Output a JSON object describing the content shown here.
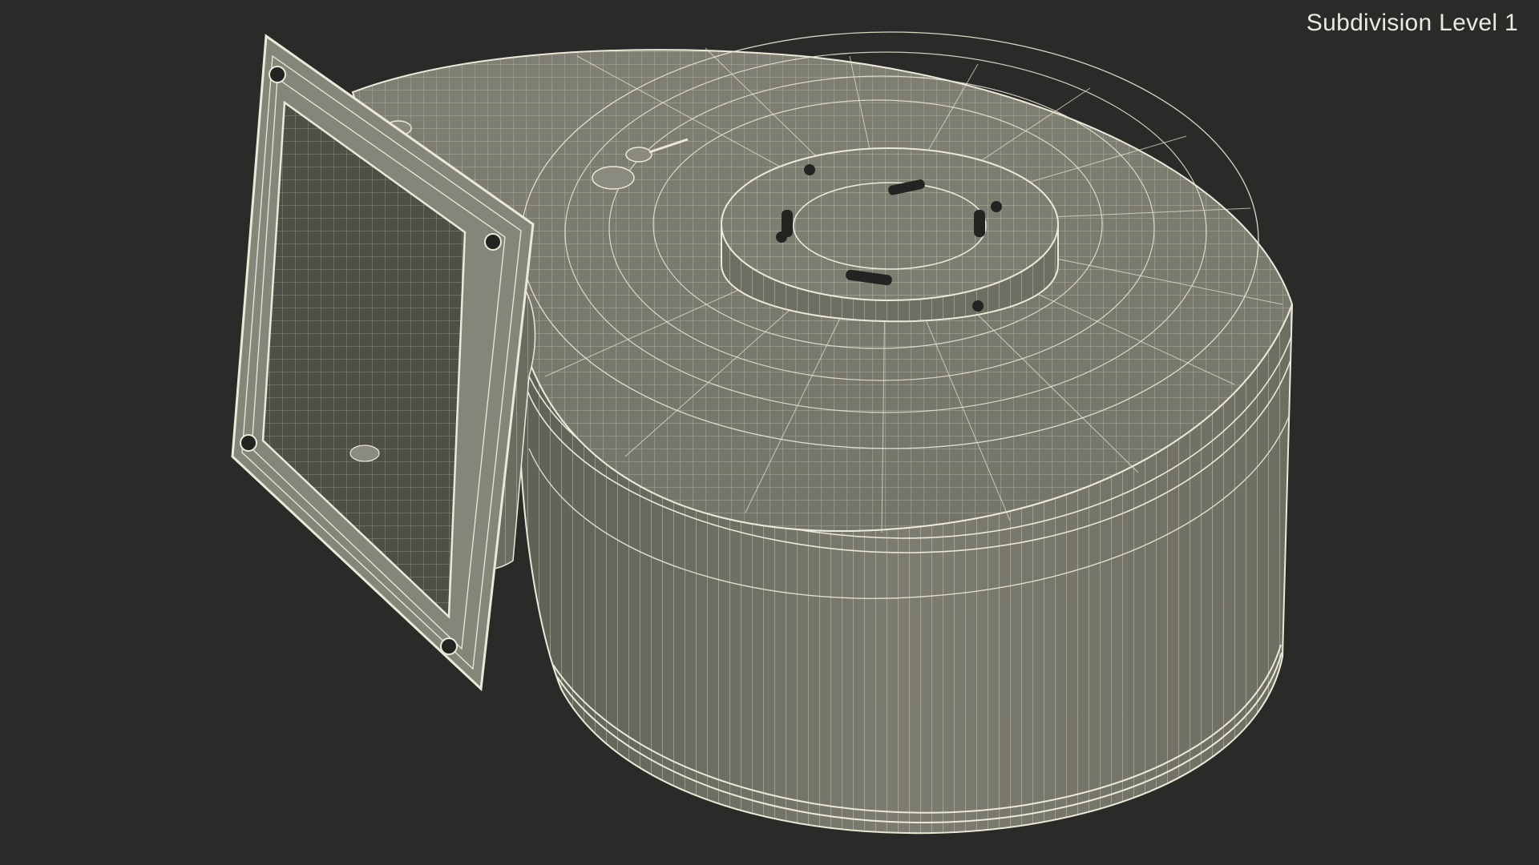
{
  "viewport": {
    "label": "Subdivision Level 1"
  },
  "colors": {
    "background": "#2a2a28",
    "surface": "#7a7b6e",
    "surface_dark": "#5f6055",
    "wire": "#ece9d8",
    "label_text": "#e9e9e4"
  },
  "model": {
    "name": "centrifugal-blower-wireframe",
    "render_mode": "wireframe-on-shaded"
  }
}
